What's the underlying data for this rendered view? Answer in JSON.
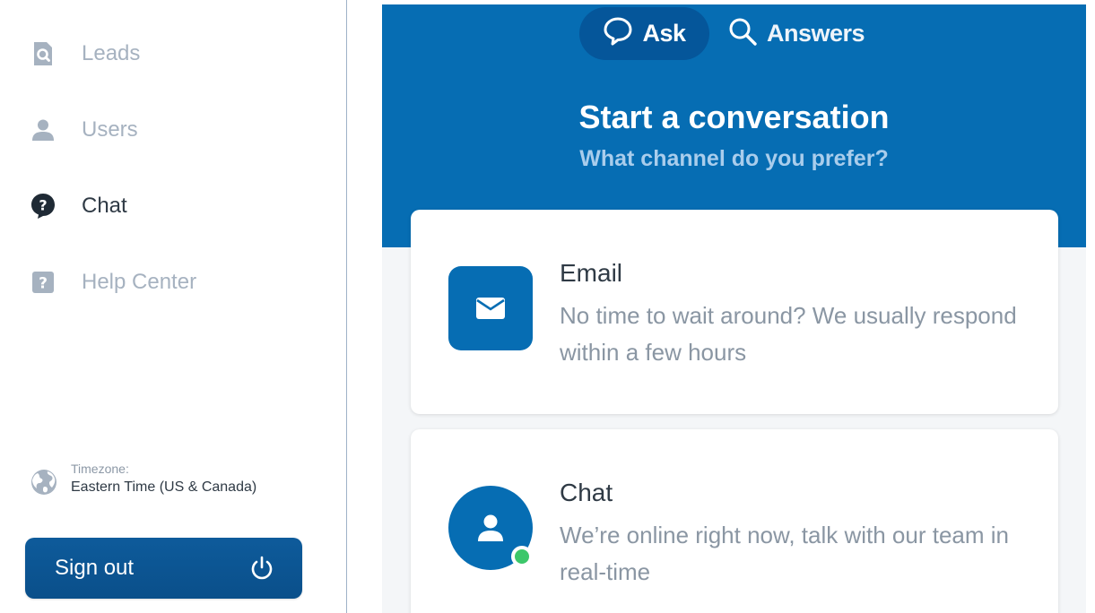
{
  "sidebar": {
    "items": [
      {
        "label": "Leads",
        "icon": "leads-search-icon",
        "active": false
      },
      {
        "label": "Users",
        "icon": "user-icon",
        "active": false
      },
      {
        "label": "Chat",
        "icon": "question-bubble-icon",
        "active": true
      },
      {
        "label": "Help Center",
        "icon": "help-square-icon",
        "active": false
      }
    ],
    "timezone": {
      "caption": "Timezone:",
      "value": "Eastern Time (US & Canada)",
      "icon": "globe-icon"
    },
    "signout": {
      "label": "Sign out",
      "icon": "power-icon"
    }
  },
  "widget": {
    "tabs": [
      {
        "label": "Ask",
        "icon": "chat-bubble-icon",
        "selected": true
      },
      {
        "label": "Answers",
        "icon": "search-icon",
        "selected": false
      }
    ],
    "title": "Start a conversation",
    "subtitle": "What channel do you prefer?",
    "channels": [
      {
        "title": "Email",
        "description": "No time to wait around? We usually respond within a few hours",
        "icon": "envelope-icon"
      },
      {
        "title": "Chat",
        "description": "We’re online right now, talk with our team in real-time",
        "icon": "user-icon",
        "status": "online"
      }
    ]
  },
  "colors": {
    "brand": "#066db3",
    "brand_dark": "#05569a",
    "subtitle": "#a9cdec",
    "online": "#3cc76a",
    "muted_text": "#a6b2c0"
  }
}
